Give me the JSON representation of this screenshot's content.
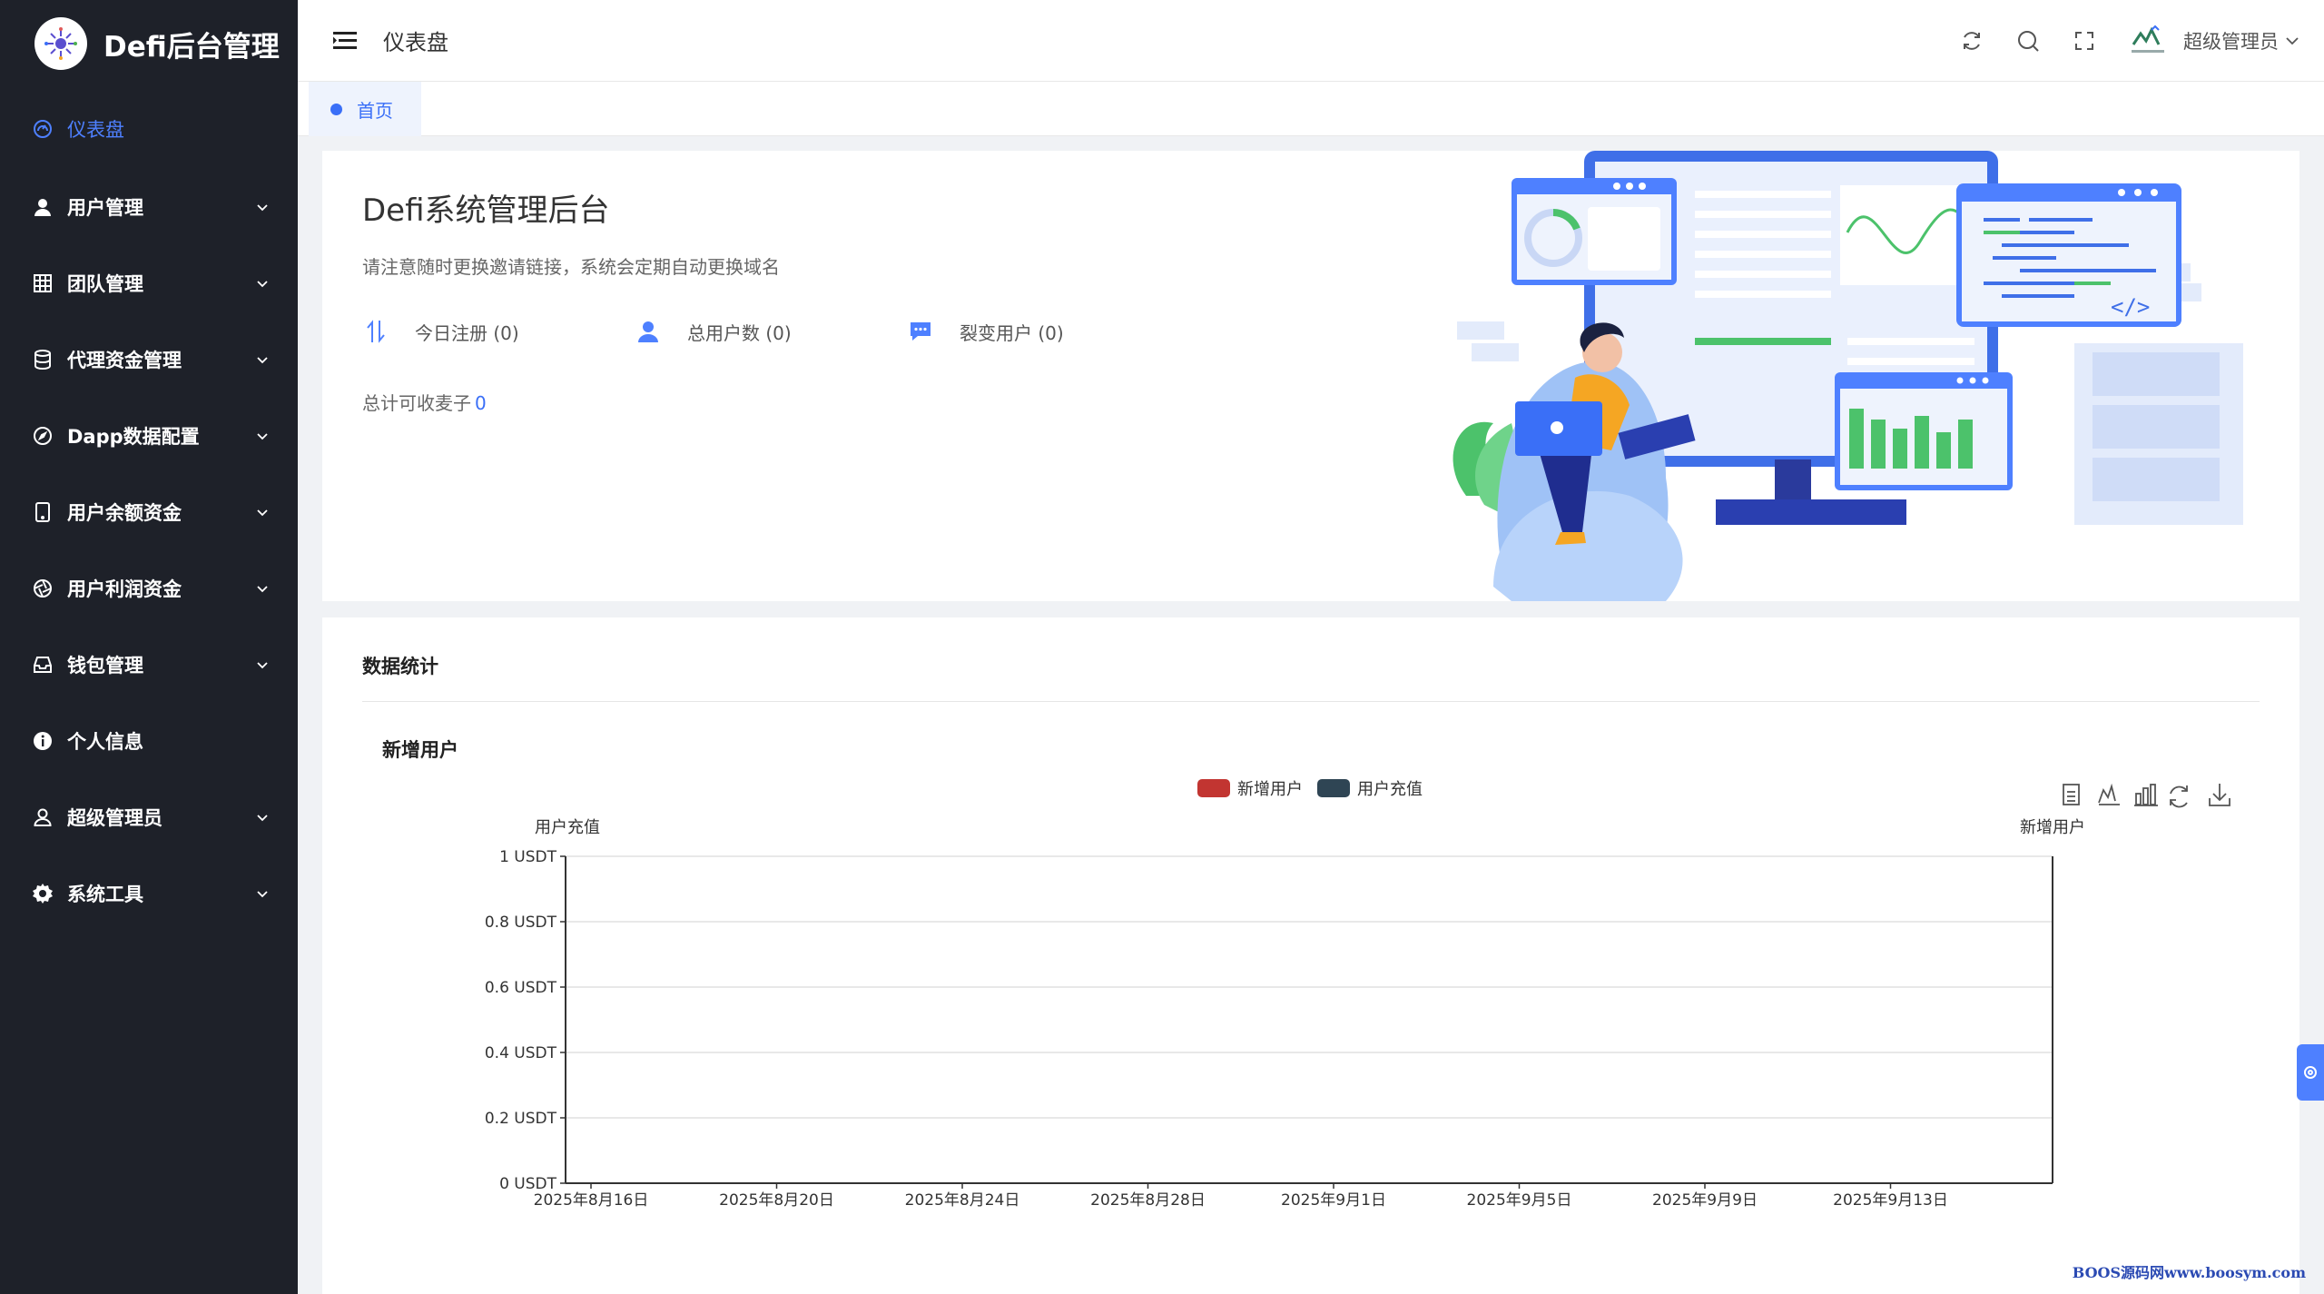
{
  "brand": {
    "title": "Defi后台管理",
    "logo_icon": "spark-logo-icon"
  },
  "sidebar": {
    "items": [
      {
        "label": "仪表盘",
        "icon": "dashboard-icon",
        "active": true,
        "expandable": false
      },
      {
        "label": "用户管理",
        "icon": "user-icon",
        "expandable": true
      },
      {
        "label": "团队管理",
        "icon": "grid-icon",
        "expandable": true
      },
      {
        "label": "代理资金管理",
        "icon": "database-icon",
        "expandable": true
      },
      {
        "label": "Dapp数据配置",
        "icon": "compass-icon",
        "expandable": true
      },
      {
        "label": "用户余额资金",
        "icon": "tablet-icon",
        "expandable": true
      },
      {
        "label": "用户利润资金",
        "icon": "aperture-icon",
        "expandable": true
      },
      {
        "label": "钱包管理",
        "icon": "inbox-icon",
        "expandable": true
      },
      {
        "label": "个人信息",
        "icon": "info-icon",
        "expandable": false
      },
      {
        "label": "超级管理员",
        "icon": "user-outline-icon",
        "expandable": true
      },
      {
        "label": "系统工具",
        "icon": "gear-icon",
        "expandable": true
      }
    ]
  },
  "header": {
    "title": "仪表盘",
    "user_name": "超级管理员",
    "tools": [
      "refresh-icon",
      "search-icon",
      "fullscreen-icon"
    ]
  },
  "tabs": [
    {
      "label": "首页",
      "active": true
    }
  ],
  "welcome": {
    "title": "Defi系统管理后台",
    "subtitle": "请注意随时更换邀请链接，系统会定期自动更换域名",
    "stats": [
      {
        "label": "今日注册 (0)",
        "icon": "transfer-arrows-icon"
      },
      {
        "label": "总用户数 (0)",
        "icon": "user-icon"
      },
      {
        "label": "裂变用户 (0)",
        "icon": "chat-icon"
      }
    ],
    "total_label": "总计可收麦子",
    "total_value": "0"
  },
  "data_card": {
    "title": "数据统计",
    "chart_title": "新增用户"
  },
  "chart_data": {
    "type": "line",
    "title": "新增用户",
    "legend": [
      "新增用户",
      "用户充值"
    ],
    "legend_colors": [
      "#c23531",
      "#2f4554"
    ],
    "legend_position": "top-center",
    "y_left_name": "用户充值",
    "y_right_name": "新增用户",
    "y_ticks": [
      "0  USDT",
      "0.2  USDT",
      "0.4  USDT",
      "0.6  USDT",
      "0.8  USDT",
      "1  USDT"
    ],
    "ylim": [
      0,
      1
    ],
    "x_ticks": [
      "2025年8月16日",
      "2025年8月20日",
      "2025年8月24日",
      "2025年8月28日",
      "2025年9月1日",
      "2025年9月5日",
      "2025年9月9日",
      "2025年9月13日"
    ],
    "series": [
      {
        "name": "新增用户",
        "values": []
      },
      {
        "name": "用户充值",
        "values": []
      }
    ],
    "grid": true,
    "toolbox": [
      "data-view-icon",
      "line-chart-icon",
      "bar-chart-icon",
      "restore-icon",
      "download-icon"
    ]
  },
  "watermark": "BOOS源码网www.boosym.com"
}
